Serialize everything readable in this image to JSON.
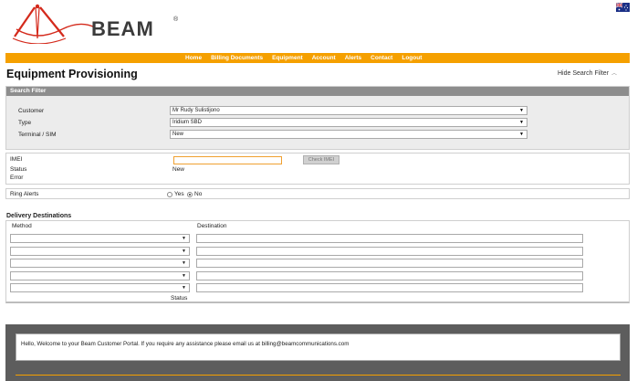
{
  "brand": {
    "name": "BEAM",
    "registered": "®",
    "accent": "#f5a000",
    "logo_red": "#d42a1c"
  },
  "nav": {
    "items": [
      "Home",
      "Billing Documents",
      "Equipment",
      "Account",
      "Alerts",
      "Contact",
      "Logout"
    ]
  },
  "page": {
    "title": "Equipment Provisioning",
    "hide_filter": "Hide Search Filter"
  },
  "search_filter": {
    "header": "Search Filter",
    "customer": {
      "label": "Customer",
      "value": "Mr Rudy Sulistijono"
    },
    "type": {
      "label": "Type",
      "value": "Iridium SBD"
    },
    "terminal": {
      "label": "Terminal / SIM",
      "value": "New"
    }
  },
  "imei": {
    "label": "IMEI",
    "value": "",
    "check_button": "Check IMEI",
    "status_label": "Status",
    "status_value": "New",
    "error_label": "Error"
  },
  "ring_alerts": {
    "label": "Ring Alerts",
    "yes": "Yes",
    "no": "No",
    "selected": "No"
  },
  "delivery": {
    "title": "Delivery Destinations",
    "method_header": "Method",
    "destination_header": "Destination",
    "status_label": "Status",
    "rows": [
      {
        "method": "",
        "destination": ""
      },
      {
        "method": "",
        "destination": ""
      },
      {
        "method": "",
        "destination": ""
      },
      {
        "method": "",
        "destination": ""
      },
      {
        "method": "",
        "destination": ""
      }
    ]
  },
  "footer": {
    "welcome": "Hello, Welcome to your Beam Customer Portal. If you require any assistance please email us at billing@beamcommunications.com"
  }
}
